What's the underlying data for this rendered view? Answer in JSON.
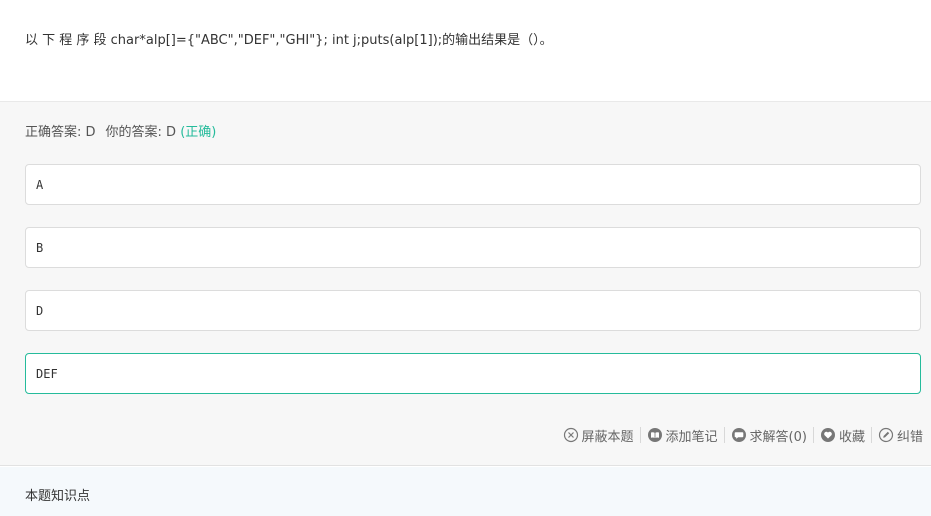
{
  "question": {
    "text": "以 下 程 序 段 char*alp[]={\"ABC\",\"DEF\",\"GHI\"};  int  j;puts(alp[1]);的输出结果是（）。"
  },
  "result": {
    "correct_label": "正确答案: D",
    "your_label": "你的答案: D",
    "status": "(正确)",
    "status_color": "#25bb9b"
  },
  "options": [
    {
      "text": "A",
      "selected": false
    },
    {
      "text": "B",
      "selected": false
    },
    {
      "text": "D",
      "selected": false
    },
    {
      "text": "DEF",
      "selected": true
    }
  ],
  "toolbar": {
    "hide_label": "屏蔽本题",
    "note_label": "添加笔记",
    "ask_label": "求解答(0)",
    "fav_label": "收藏",
    "report_label": "纠错"
  },
  "knowledge": {
    "title": "本题知识点"
  }
}
